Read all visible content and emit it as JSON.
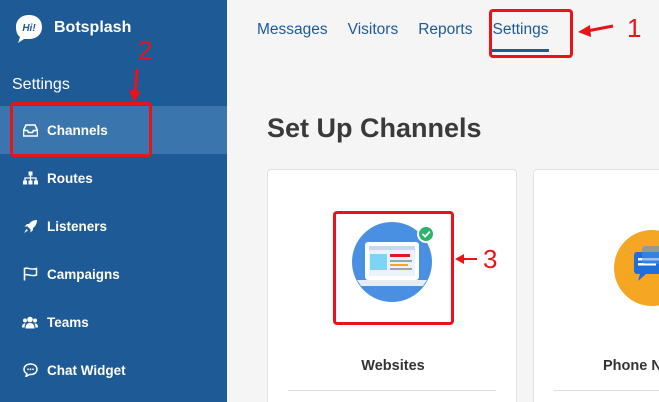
{
  "brand": {
    "logo_text": "Hi!",
    "name": "Botsplash"
  },
  "sidebar": {
    "section_title": "Settings",
    "items": [
      {
        "label": "Channels",
        "icon": "inbox-icon",
        "active": true
      },
      {
        "label": "Routes",
        "icon": "sitemap-icon",
        "active": false
      },
      {
        "label": "Listeners",
        "icon": "rocket-icon",
        "active": false
      },
      {
        "label": "Campaigns",
        "icon": "flag-icon",
        "active": false
      },
      {
        "label": "Teams",
        "icon": "users-icon",
        "active": false
      },
      {
        "label": "Chat Widget",
        "icon": "chat-bubble-icon",
        "active": false
      }
    ]
  },
  "tabs": [
    {
      "label": "Messages",
      "active": false
    },
    {
      "label": "Visitors",
      "active": false
    },
    {
      "label": "Reports",
      "active": false
    },
    {
      "label": "Settings",
      "active": true
    }
  ],
  "main": {
    "title": "Set Up Channels",
    "cards": [
      {
        "label": "Websites",
        "icon": "laptop-website-icon",
        "configured": true
      },
      {
        "label": "Phone N",
        "icon": "sms-chat-icon",
        "configured": false
      }
    ]
  },
  "annotations": {
    "n1": "1",
    "n2": "2",
    "n3": "3"
  },
  "colors": {
    "sidebar": "#1e5a96",
    "sidebar_active": "#3a75ae",
    "accent_red": "#e8141a",
    "tab_text": "#1e5a96",
    "check_green": "#2fb36b",
    "website_circle": "#4a90e2",
    "phone_circle": "#f5a623"
  }
}
